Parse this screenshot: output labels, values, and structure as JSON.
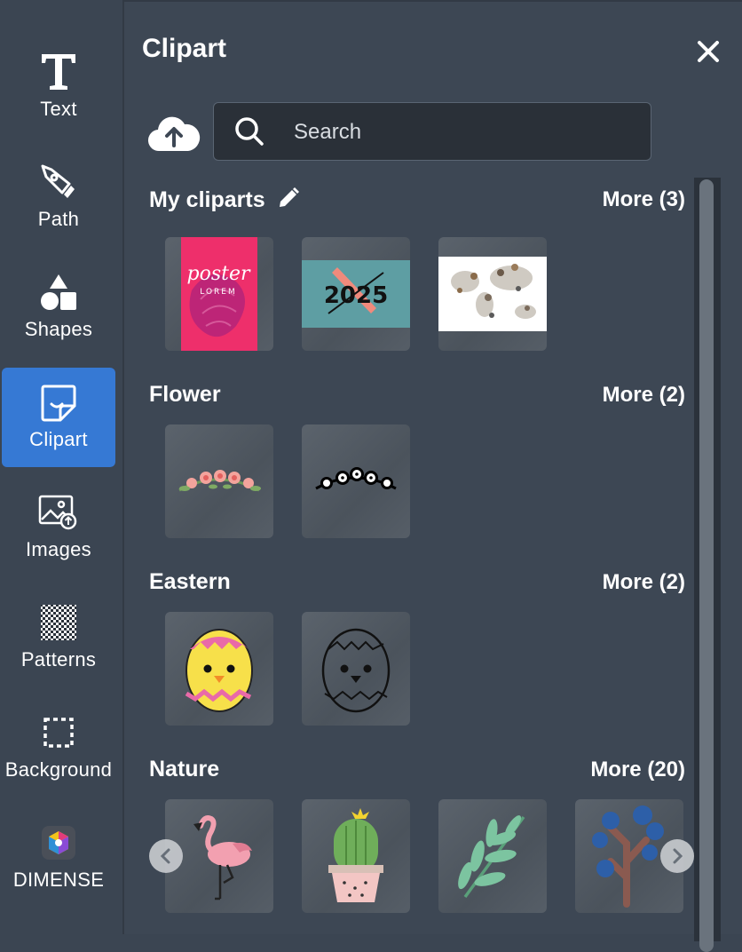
{
  "sidebar": {
    "items": [
      {
        "label": "Text",
        "icon": "text-icon"
      },
      {
        "label": "Path",
        "icon": "pen-tool-icon"
      },
      {
        "label": "Shapes",
        "icon": "shapes-icon"
      },
      {
        "label": "Clipart",
        "icon": "sticker-icon",
        "active": true
      },
      {
        "label": "Images",
        "icon": "image-upload-icon"
      },
      {
        "label": "Patterns",
        "icon": "pattern-icon"
      },
      {
        "label": "Background",
        "icon": "dashed-square-icon"
      },
      {
        "label": "DIMENSE",
        "icon": "dimense-logo-icon"
      }
    ]
  },
  "panel": {
    "title": "Clipart",
    "search_placeholder": "Search",
    "sections": [
      {
        "title": "My cliparts",
        "more": "More (3)",
        "editable": true,
        "items": [
          "poster LOREM",
          "2025",
          "world animal map"
        ]
      },
      {
        "title": "Flower",
        "more": "More (2)",
        "items": [
          "pink flower garland",
          "black white flower garland"
        ]
      },
      {
        "title": "Eastern",
        "more": "More (2)",
        "items": [
          "chick egg color",
          "chick egg outline"
        ]
      },
      {
        "title": "Nature",
        "more": "More (20)",
        "items": [
          "flamingo",
          "cactus",
          "leaf branch",
          "blue tree"
        ]
      }
    ],
    "thumb_text": {
      "poster_word": "poster",
      "poster_sub": "LOREM",
      "year": "2025"
    }
  },
  "colors": {
    "accent": "#3679d4",
    "panel_bg": "#3d4754",
    "sidebar_bg": "#3b4552"
  }
}
